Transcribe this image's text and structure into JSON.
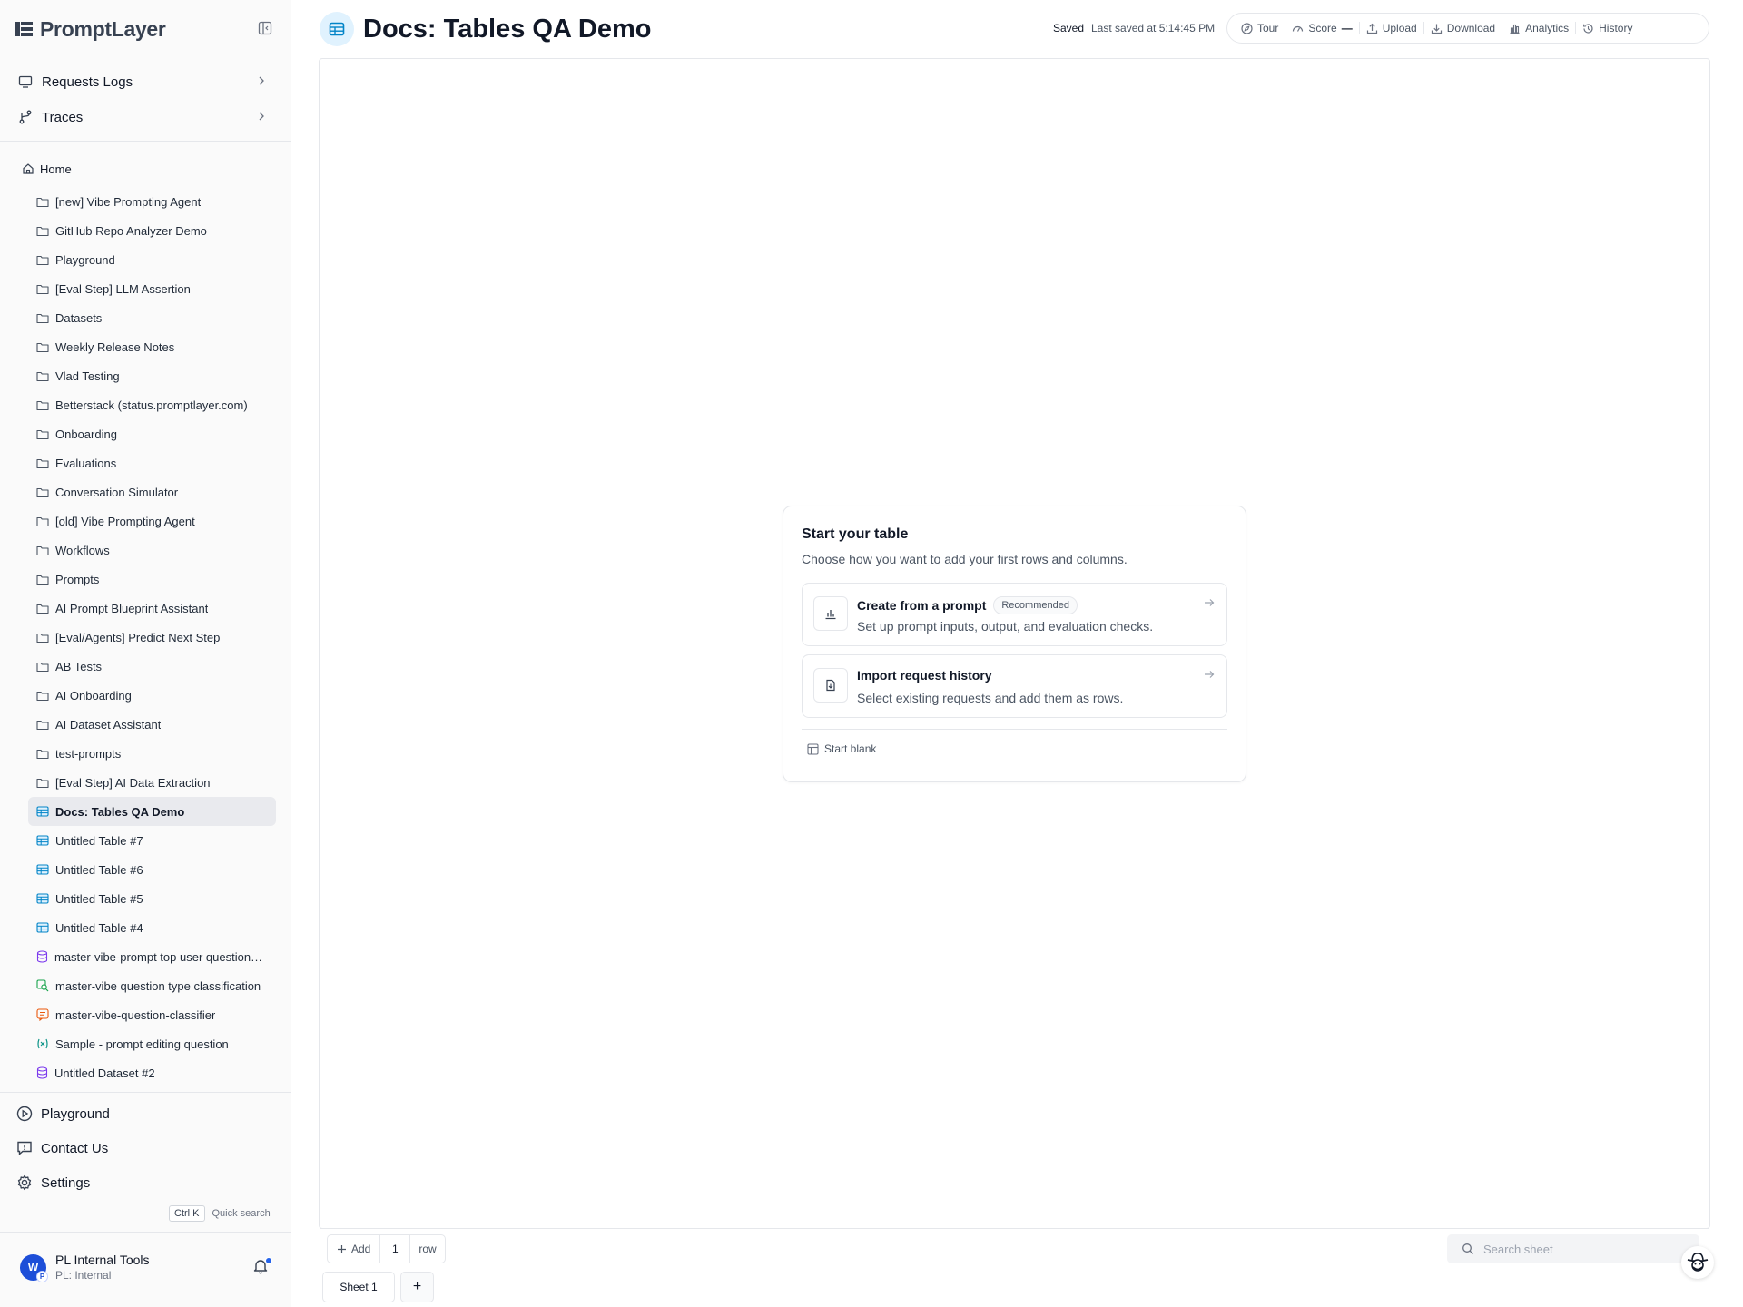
{
  "brand": {
    "name": "PromptLayer"
  },
  "sidebar": {
    "top_nav": [
      {
        "label": "Requests Logs",
        "icon": "monitor-icon"
      },
      {
        "label": "Traces",
        "icon": "branch-icon"
      }
    ],
    "home_label": "Home",
    "tree": [
      {
        "label": "[new] Vibe Prompting Agent",
        "icon": "folder-icon"
      },
      {
        "label": "GitHub Repo Analyzer Demo",
        "icon": "folder-icon"
      },
      {
        "label": "Playground",
        "icon": "folder-icon"
      },
      {
        "label": "[Eval Step] LLM Assertion",
        "icon": "folder-icon"
      },
      {
        "label": "Datasets",
        "icon": "folder-icon"
      },
      {
        "label": "Weekly Release Notes",
        "icon": "folder-icon"
      },
      {
        "label": "Vlad Testing",
        "icon": "folder-icon"
      },
      {
        "label": "Betterstack (status.promptlayer.com)",
        "icon": "folder-icon"
      },
      {
        "label": "Onboarding",
        "icon": "folder-icon"
      },
      {
        "label": "Evaluations",
        "icon": "folder-icon"
      },
      {
        "label": "Conversation Simulator",
        "icon": "folder-icon"
      },
      {
        "label": "[old] Vibe Prompting Agent",
        "icon": "folder-icon"
      },
      {
        "label": "Workflows",
        "icon": "folder-icon"
      },
      {
        "label": "Prompts",
        "icon": "folder-icon"
      },
      {
        "label": "AI Prompt Blueprint Assistant",
        "icon": "folder-icon"
      },
      {
        "label": "[Eval/Agents] Predict Next Step",
        "icon": "folder-icon"
      },
      {
        "label": "AB Tests",
        "icon": "folder-icon"
      },
      {
        "label": "AI Onboarding",
        "icon": "folder-icon"
      },
      {
        "label": "AI Dataset Assistant",
        "icon": "folder-icon"
      },
      {
        "label": "test-prompts",
        "icon": "folder-icon"
      },
      {
        "label": "[Eval Step] AI Data Extraction",
        "icon": "folder-icon"
      },
      {
        "label": "Docs: Tables QA Demo",
        "icon": "table-icon",
        "active": true
      },
      {
        "label": "Untitled Table #7",
        "icon": "table-icon"
      },
      {
        "label": "Untitled Table #6",
        "icon": "table-icon"
      },
      {
        "label": "Untitled Table #5",
        "icon": "table-icon"
      },
      {
        "label": "Untitled Table #4",
        "icon": "table-icon"
      },
      {
        "label": "master-vibe-prompt top user question…",
        "icon": "database-icon"
      },
      {
        "label": "master-vibe question type classification",
        "icon": "eval-icon"
      },
      {
        "label": "master-vibe-question-classifier",
        "icon": "prompt-icon"
      },
      {
        "label": "Sample - prompt editing question",
        "icon": "variable-icon"
      },
      {
        "label": "Untitled Dataset #2",
        "icon": "database-icon"
      }
    ],
    "bottom_nav": [
      {
        "label": "Playground",
        "icon": "play-circle-icon"
      },
      {
        "label": "Contact Us",
        "icon": "message-alert-icon"
      },
      {
        "label": "Settings",
        "icon": "gear-icon"
      }
    ],
    "quick_search": {
      "kbd": "Ctrl K",
      "label": "Quick search"
    },
    "workspace": {
      "avatar_letter": "W",
      "avatar_sub": "P",
      "name": "PL Internal Tools",
      "sub": "PL: Internal"
    }
  },
  "header": {
    "title": "Docs: Tables QA Demo",
    "saved": "Saved",
    "last_saved": "Last saved at 5:14:45 PM",
    "toolbar": {
      "tour": "Tour",
      "score": "Score",
      "score_value": "—",
      "upload": "Upload",
      "download": "Download",
      "analytics": "Analytics",
      "history": "History"
    }
  },
  "start_card": {
    "title": "Start your table",
    "description": "Choose how you want to add your first rows and columns.",
    "options": [
      {
        "title": "Create from a prompt",
        "badge": "Recommended",
        "subtitle": "Set up prompt inputs, output, and evaluation checks."
      },
      {
        "title": "Import request history",
        "subtitle": "Select existing requests and add them as rows."
      }
    ],
    "start_blank": "Start blank"
  },
  "bottom_bar": {
    "add_label": "Add",
    "row_count": "1",
    "row_suffix": "row",
    "search_placeholder": "Search sheet"
  },
  "sheets": {
    "tabs": [
      "Sheet 1"
    ],
    "add_label": "+"
  },
  "colors": {
    "accent": "#0284c7",
    "active_item_bg": "#e9eaee",
    "notification_dot": "#2563eb"
  }
}
